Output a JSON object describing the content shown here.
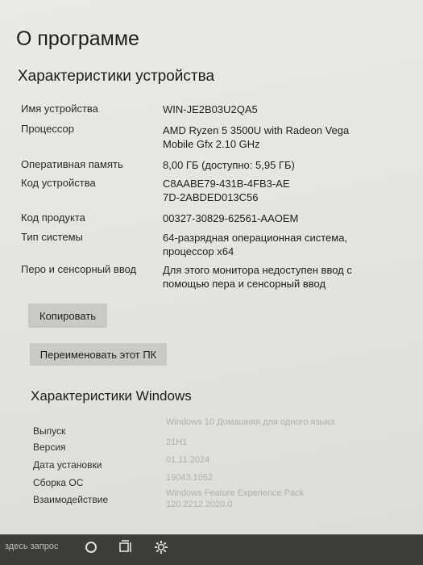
{
  "page_title": "О программе",
  "device_specs": {
    "title": "Характеристики устройства",
    "rows": [
      {
        "label": "Имя устройства",
        "value": "WIN-JE2B03U2QA5"
      },
      {
        "label": "Процессор",
        "value": "AMD Ryzen 5 3500U with Radeon Vega Mobile Gfx     2.10 GHz"
      },
      {
        "label": "Оперативная память",
        "value": "8,00 ГБ (доступно: 5,95 ГБ)"
      },
      {
        "label": "Код устройства",
        "value": "C8AABE79-431B-4FB3-AE7D-2ABDED013C56"
      },
      {
        "label": "Код продукта",
        "value": "00327-30829-62561-AAOEM"
      },
      {
        "label": "Тип системы",
        "value": "64-разрядная операционная система, процессор x64"
      },
      {
        "label": "Перо и сенсорный ввод",
        "value": "Для этого монитора недоступен ввод с помощью пера и сенсорный ввод"
      }
    ],
    "copy_button": "Копировать",
    "rename_button": "Переименовать этот ПК"
  },
  "windows_specs": {
    "title": "Характеристики Windows",
    "rows": [
      {
        "label": "Выпуск",
        "value": "Windows 10 Домашняя для одного языка"
      },
      {
        "label": "Версия",
        "value": "21H1"
      },
      {
        "label": "Дата установки",
        "value": "01.11.2024"
      },
      {
        "label": "Сборка ОС",
        "value": "19043.1052"
      },
      {
        "label": "Взаимодействие",
        "value": "Windows Feature Experience Pack 120.2212.2020.0"
      }
    ]
  },
  "taskbar": {
    "search_placeholder": "здесь запрос",
    "icons": [
      "cortana-icon",
      "task-view-icon",
      "settings-icon"
    ]
  }
}
